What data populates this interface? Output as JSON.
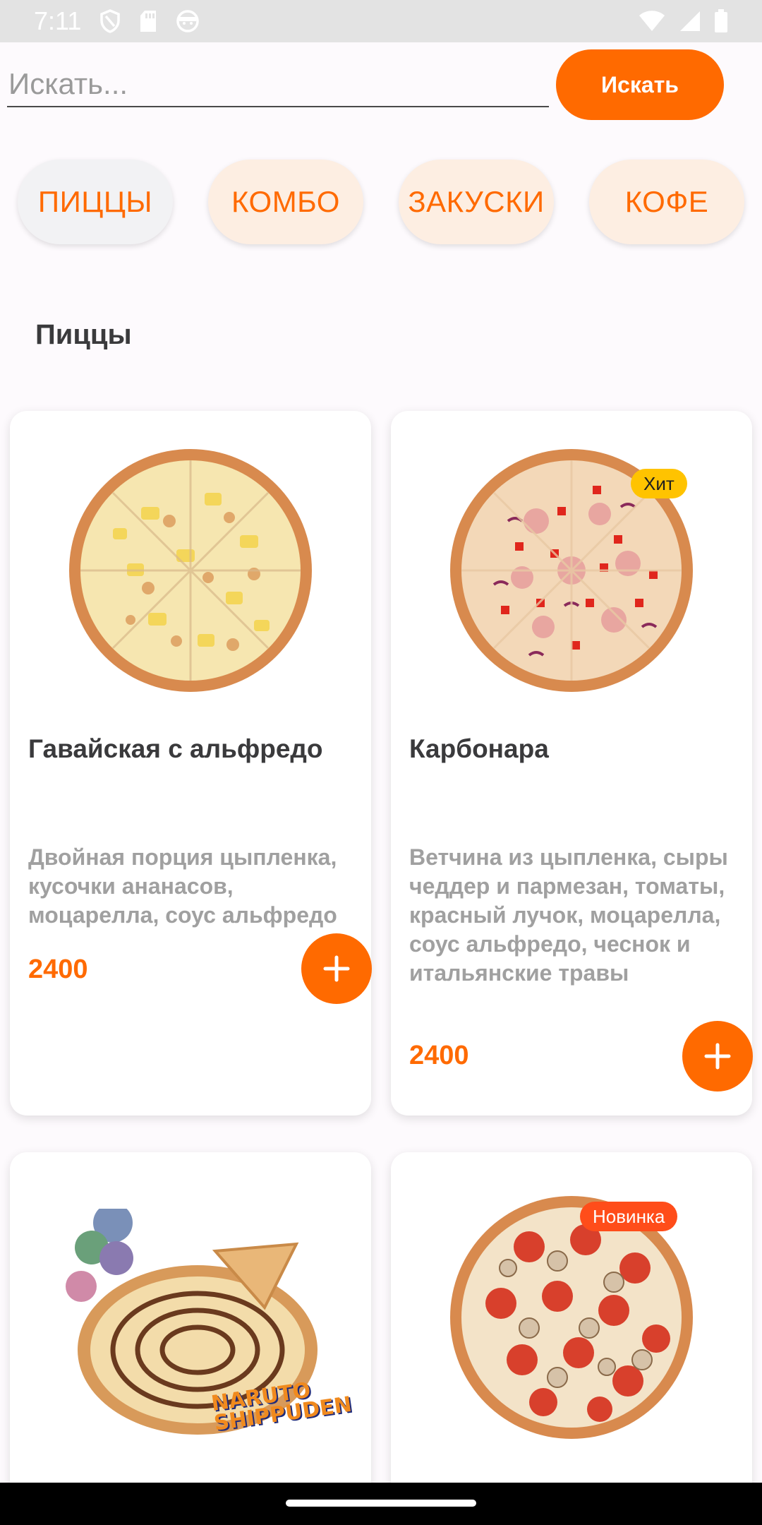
{
  "status_bar": {
    "time": "7:11",
    "left_icons": [
      "shield-icon",
      "sd-card-icon",
      "face-icon"
    ],
    "right_icons": [
      "wifi-icon",
      "signal-icon",
      "battery-icon"
    ]
  },
  "search": {
    "placeholder": "Искать...",
    "button_label": "Искать"
  },
  "categories": [
    {
      "label": "ПИЦЦЫ",
      "active": true
    },
    {
      "label": "КОМБО",
      "active": false
    },
    {
      "label": "ЗАКУСКИ",
      "active": false
    },
    {
      "label": "КОФЕ",
      "active": false
    }
  ],
  "section_title": "Пиццы",
  "products": [
    {
      "name": "Гавайская с альфредо",
      "description": "Двойная порция цыпленка, кусочки ананасов, моцарелла, соус альфредо",
      "price": "2400",
      "badge": ""
    },
    {
      "name": "Карбонара",
      "description": "Ветчина из цыпленка, сыры чеддер и пармезан, томаты, красный лучок, моцарелла, соус альфредо, чеснок и итальянские травы",
      "price": "2400",
      "badge": "Хит"
    },
    {
      "name": "",
      "description": "",
      "price": "",
      "badge": "",
      "logo_text": "NARUTO SHIPPUDEN"
    },
    {
      "name": "",
      "description": "",
      "price": "",
      "badge": "Новинка"
    }
  ],
  "colors": {
    "accent": "#ff6a00",
    "chip_bg": "#fdeee2",
    "chip_active_bg": "#f2f2f4",
    "badge_hit": "#ffc300",
    "badge_new": "#ff4d1a"
  }
}
